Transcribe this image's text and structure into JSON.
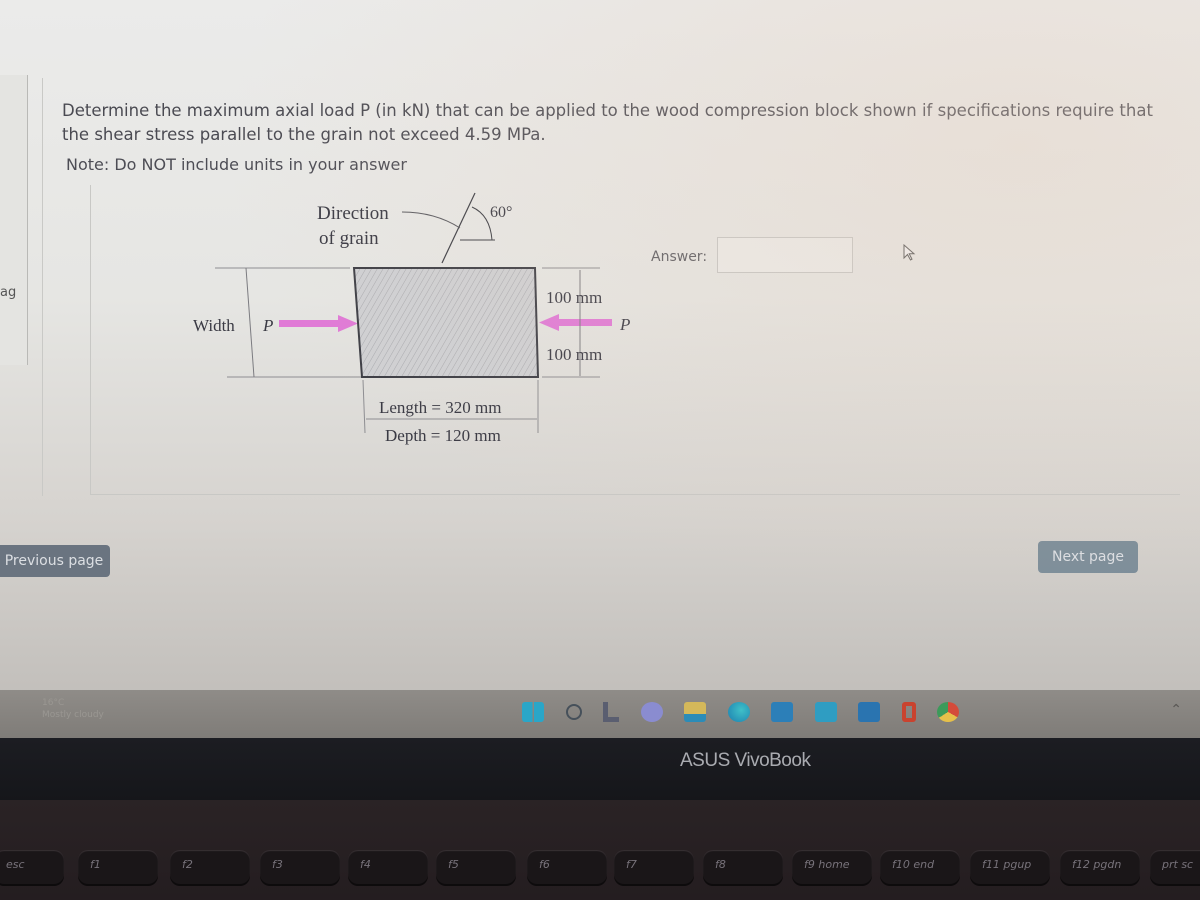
{
  "question": {
    "text": "Determine the maximum axial load P (in kN) that can be applied to the wood compression block shown if specifications require that the shear stress parallel to the grain not exceed 4.59 MPa.",
    "note": "Note: Do NOT include units in your answer"
  },
  "left_panel": {
    "label": "ag"
  },
  "figure": {
    "grain_label_line1": "Direction",
    "grain_label_line2": "of grain",
    "angle_label": "60°",
    "width_label": "Width",
    "load_left_label": "P",
    "load_right_label": "P",
    "dim_top": "100 mm",
    "dim_bottom": "100 mm",
    "length_label": "Length = 320 mm",
    "depth_label": "Depth = 120 mm",
    "arrow_color": "#e07ad6"
  },
  "answer": {
    "label": "Answer:",
    "value": ""
  },
  "navigation": {
    "previous": "Previous page",
    "next": "Next page"
  },
  "taskbar": {
    "weather_temp": "16°C",
    "weather_desc": "Mostly cloudy",
    "icons": [
      "windows-start-icon",
      "search-icon",
      "widgets-icon",
      "chat-icon",
      "file-explorer-icon",
      "edge-icon",
      "store-icon",
      "mail-icon",
      "outlook-icon",
      "office-icon",
      "chrome-icon"
    ]
  },
  "laptop": {
    "brand": "ASUS VivoBook"
  },
  "keyboard": {
    "keys": [
      "esc",
      "f1",
      "f2",
      "f3",
      "f4",
      "f5",
      "f6",
      "f7",
      "f8",
      "f9 home",
      "f10 end",
      "f11 pgup",
      "f12 pgdn",
      "prt sc"
    ]
  }
}
